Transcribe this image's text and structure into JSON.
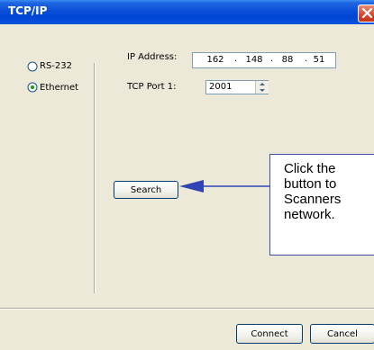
{
  "window": {
    "title": "TCP/IP"
  },
  "connection": {
    "options": [
      {
        "label": "RS-232",
        "selected": false
      },
      {
        "label": "Ethernet",
        "selected": true
      }
    ]
  },
  "ip": {
    "label": "IP Address:",
    "octets": [
      "162",
      "148",
      "88",
      "51"
    ]
  },
  "port": {
    "label": "TCP Port 1:",
    "value": "2001"
  },
  "buttons": {
    "search": "Search",
    "connect": "Connect",
    "cancel": "Cancel"
  },
  "callout": {
    "lines": [
      "Click the",
      "button to",
      "Scanners",
      "network."
    ]
  },
  "colors": {
    "titlebar": "#0a4fd8",
    "callout_border": "#3f4fa8",
    "arrow": "#2f43b5",
    "close": "#d8452b"
  },
  "icons": [
    "close-icon",
    "spinner-up-icon",
    "spinner-down-icon",
    "arrow-icon"
  ]
}
